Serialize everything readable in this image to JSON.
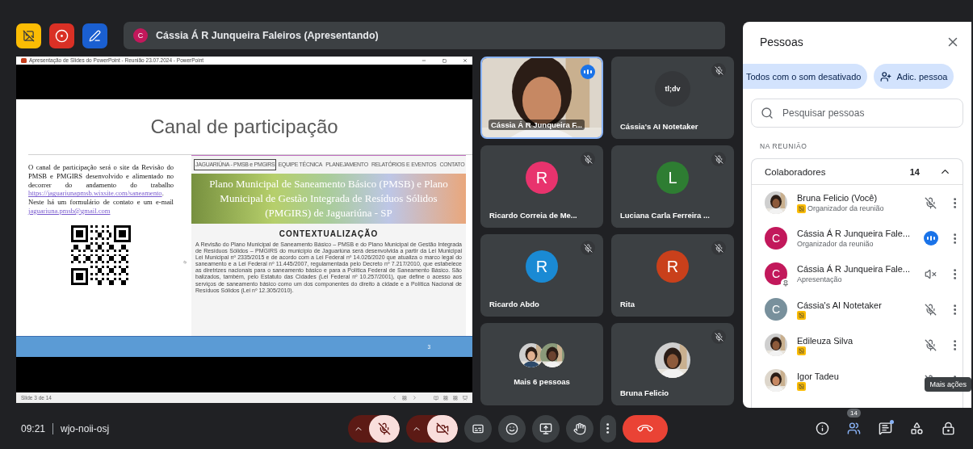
{
  "top_bar": {
    "presenter": {
      "avatar": "C",
      "color": "#c2185b",
      "text": "Cássia Á R Junqueira Faleiros (Apresentando)"
    }
  },
  "shared_window": {
    "title": "Apresentação de Slides do PowerPoint  -  Reunião 23.07.2024  -  PowerPoint",
    "slide": {
      "title": "Canal de participação",
      "text_before": "O canal de participação será o site da Revisão do PMSB e PMGIRS desenvolvido e alimentado no decorrer do andamento do trabalho",
      "link": "https://jaguariunapmsb.wixsite.com/saneamento",
      "text_middle": ". Neste há um formulário de contato e um e-mail",
      "email": "jaguariuna.pmsb@gmail.com",
      "site": {
        "nav": [
          {
            "label": "JAGUARIÚNA - PMSB e PMGIRS",
            "selected": true
          },
          {
            "label": "EQUIPE TÉCNICA",
            "selected": false
          },
          {
            "label": "PLANEJAMENTO",
            "selected": false
          },
          {
            "label": "RELATÓRIOS E EVENTOS",
            "selected": false
          },
          {
            "label": "CONTATO",
            "selected": false
          }
        ],
        "banner": "Plano Municipal de Saneamento Básico (PMSB) e Plano Municipal de Gestão Integrada de Resíduos Sólidos (PMGIRS) de Jaguariúna - SP",
        "heading": "CONTEXTUALIZAÇÃO",
        "paragraph": "A Revisão do Plano Municipal de Saneamento Básico – PMSB e do Plano Municipal de Gestão Integrada de Resíduos Sólidos – PMGIRS do município de Jaguariúna será desenvolvida a partir da Lei Municipal Lei Municipal nº 2335/2015 e de acordo com a Lei Federal nº 14.026/2020 que atualiza o marco legal do saneamento e a Lei Federal nº 11.445/2007, regulamentada pelo Decreto nº 7.217/2010, que estabelece as diretrizes nacionais para o saneamento básico e para a Política Federal de Saneamento Básico. São balizados, também, pelo Estatuto das Cidades (Lei Federal nº 10.257/2001), que define o acesso aos serviços de saneamento básico como um dos componentes do direito à cidade e a Política Nacional de Resíduos Sólidos (Lei nº 12.305/2010)."
      },
      "page_number": "3"
    },
    "status": "Slide 3 de 14"
  },
  "tiles": [
    {
      "kind": "video",
      "name": "Cássia Á R Junqueira F...",
      "speaking": true,
      "muted": false
    },
    {
      "kind": "logo",
      "name": "Cássia's AI Notetaker",
      "logo": "tl;dv",
      "speaking": false,
      "muted": true
    },
    {
      "kind": "avatar",
      "name": "Ricardo Correia de Me...",
      "letter": "R",
      "color": "#e8336d",
      "speaking": false,
      "muted": true
    },
    {
      "kind": "avatar",
      "name": "Luciana Carla Ferreira ...",
      "letter": "L",
      "color": "#2e7d32",
      "speaking": false,
      "muted": true
    },
    {
      "kind": "avatar",
      "name": "Ricardo Abdo",
      "letter": "R",
      "color": "#1a8ad4",
      "speaking": false,
      "muted": true
    },
    {
      "kind": "avatar",
      "name": "Rita",
      "letter": "R",
      "color": "#c9401b",
      "speaking": false,
      "muted": true
    },
    {
      "kind": "group",
      "name": "Mais 6 pessoas",
      "speaking": false,
      "muted": false
    },
    {
      "name": "Bruna Felicio",
      "speaking": false,
      "muted": true
    }
  ],
  "people_panel": {
    "title": "Pessoas",
    "mute_all": "Todos com o som desativado",
    "add_people": "Adic. pessoa",
    "search": {
      "placeholder": "Pesquisar pessoas"
    },
    "section": "NA REUNIÃO",
    "group": {
      "label": "Colaboradores",
      "count": "14",
      "expanded": true
    },
    "members": [
      {
        "name": "Bruna Felicio (Você)",
        "role": "Organizador da reunião",
        "photo": true,
        "host_badge": true,
        "muted": true
      },
      {
        "name": "Cássia Á R Junqueira Fale...",
        "role": "Organizador da reunião",
        "photo": false,
        "avatar": "C",
        "color": "#c2185b",
        "host_badge": false,
        "speaking": true
      },
      {
        "name": "Cássia Á R Junqueira Fale...",
        "role": "Apresentação",
        "photo": false,
        "avatar": "C",
        "color": "#c2185b",
        "host_badge": false,
        "presentation": true
      },
      {
        "name": "Cássia's AI Notetaker",
        "photo": false,
        "avatar": "C",
        "color": "#78909c",
        "host_badge": true,
        "muted": true
      },
      {
        "name": "Edileuza Silva",
        "photo": true,
        "host_badge": true,
        "muted": true
      },
      {
        "name": "Igor Tadeu",
        "photo": true,
        "host_badge": true,
        "muted": true
      }
    ],
    "tooltip": "Mais ações"
  },
  "bottom_bar": {
    "time": "09:21",
    "meeting_code": "wjo-noii-osj",
    "mic_on": false,
    "camera_on": false,
    "people_count": "14",
    "people_open": true,
    "chat_unread": true
  }
}
